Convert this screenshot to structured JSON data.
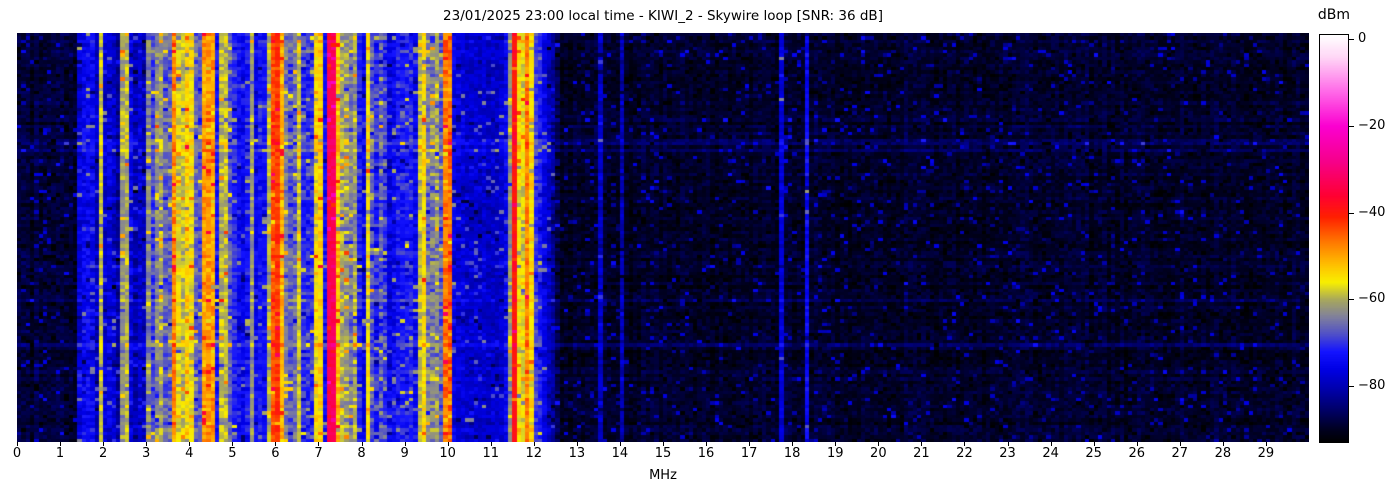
{
  "header": {
    "title": "23/01/2025 23:00 local time - KIWI_2 - Skywire loop [SNR: 36 dB]"
  },
  "chart_data": {
    "type": "heatmap",
    "subtype": "radio-spectrum-waterfall",
    "title": "23/01/2025 23:00 local time - KIWI_2 - Skywire loop [SNR: 36 dB]",
    "xlabel": "MHz",
    "x_range": [
      0,
      30
    ],
    "x_ticks": [
      0,
      1,
      2,
      3,
      4,
      5,
      6,
      7,
      8,
      9,
      10,
      11,
      12,
      13,
      14,
      15,
      16,
      17,
      18,
      19,
      20,
      21,
      22,
      23,
      24,
      25,
      26,
      27,
      28,
      29
    ],
    "y_ticks": [],
    "grid": false,
    "colorbar": {
      "label": "dBm",
      "tick_values": [
        0,
        -20,
        -40,
        -60,
        -80
      ],
      "tick_labels": [
        "0",
        "−20",
        "−40",
        "−60",
        "−80"
      ],
      "vmax": 1,
      "vmin": -93
    },
    "colormap_stops": [
      [
        -93,
        "#000000"
      ],
      [
        -90,
        "#000020"
      ],
      [
        -86,
        "#000060"
      ],
      [
        -81,
        "#0000a8"
      ],
      [
        -76,
        "#0000e6"
      ],
      [
        -72,
        "#1414ff"
      ],
      [
        -68,
        "#5050c8"
      ],
      [
        -64,
        "#80809c"
      ],
      [
        -60,
        "#a8a85c"
      ],
      [
        -56,
        "#f8ef00"
      ],
      [
        -52,
        "#ffc000"
      ],
      [
        -47,
        "#ff7c00"
      ],
      [
        -41,
        "#ff2000"
      ],
      [
        -36,
        "#ff0033"
      ],
      [
        -28,
        "#f6008c"
      ],
      [
        -20,
        "#fb00d0"
      ],
      [
        -12,
        "#ff69e8"
      ],
      [
        -4,
        "#ffd7f6"
      ],
      [
        1,
        "#ffffff"
      ]
    ],
    "noise_floor_dbm": -89.5,
    "bands": [
      {
        "f1": 0.0,
        "f2": 1.42,
        "dbm": -89,
        "colvar": 1.5,
        "cellvar": 3
      },
      {
        "f1": 1.42,
        "f2": 2.3,
        "dbm": -77,
        "colvar": 5,
        "cellvar": 5
      },
      {
        "f1": 1.93,
        "f2": 2.02,
        "dbm": -59,
        "colvar": 2,
        "cellvar": 4
      },
      {
        "f1": 2.3,
        "f2": 2.45,
        "dbm": -82,
        "colvar": 4,
        "cellvar": 5
      },
      {
        "f1": 2.45,
        "f2": 2.62,
        "dbm": -59,
        "colvar": 3,
        "cellvar": 5
      },
      {
        "f1": 2.62,
        "f2": 3.0,
        "dbm": -77,
        "colvar": 6,
        "cellvar": 6
      },
      {
        "f1": 3.0,
        "f2": 3.6,
        "dbm": -65,
        "colvar": 6,
        "cellvar": 6
      },
      {
        "f1": 3.6,
        "f2": 3.72,
        "dbm": -47,
        "colvar": 2,
        "cellvar": 6
      },
      {
        "f1": 3.72,
        "f2": 4.1,
        "dbm": -57,
        "colvar": 4,
        "cellvar": 5
      },
      {
        "f1": 4.1,
        "f2": 4.35,
        "dbm": -68,
        "colvar": 5,
        "cellvar": 5
      },
      {
        "f1": 4.35,
        "f2": 4.6,
        "dbm": -49,
        "colvar": 3,
        "cellvar": 5
      },
      {
        "f1": 4.6,
        "f2": 4.72,
        "dbm": -72,
        "colvar": 3,
        "cellvar": 4
      },
      {
        "f1": 4.72,
        "f2": 4.88,
        "dbm": -57,
        "colvar": 3,
        "cellvar": 5
      },
      {
        "f1": 4.88,
        "f2": 5.05,
        "dbm": -66,
        "colvar": 5,
        "cellvar": 6
      },
      {
        "f1": 5.05,
        "f2": 5.45,
        "dbm": -74,
        "colvar": 4,
        "cellvar": 5
      },
      {
        "f1": 5.45,
        "f2": 5.52,
        "dbm": -61,
        "colvar": 2,
        "cellvar": 4
      },
      {
        "f1": 5.52,
        "f2": 5.78,
        "dbm": -74,
        "colvar": 3,
        "cellvar": 4
      },
      {
        "f1": 5.78,
        "f2": 5.94,
        "dbm": -58,
        "colvar": 3,
        "cellvar": 5
      },
      {
        "f1": 5.94,
        "f2": 6.06,
        "dbm": -42,
        "colvar": 2,
        "cellvar": 4
      },
      {
        "f1": 6.06,
        "f2": 6.2,
        "dbm": -51,
        "colvar": 3,
        "cellvar": 5
      },
      {
        "f1": 6.2,
        "f2": 6.55,
        "dbm": -65,
        "colvar": 5,
        "cellvar": 6
      },
      {
        "f1": 6.55,
        "f2": 6.64,
        "dbm": -58,
        "colvar": 2,
        "cellvar": 4
      },
      {
        "f1": 6.64,
        "f2": 6.9,
        "dbm": -70,
        "colvar": 5,
        "cellvar": 6
      },
      {
        "f1": 6.9,
        "f2": 7.1,
        "dbm": -55,
        "colvar": 3,
        "cellvar": 5
      },
      {
        "f1": 7.1,
        "f2": 7.22,
        "dbm": -72,
        "colvar": 3,
        "cellvar": 4
      },
      {
        "f1": 7.22,
        "f2": 7.36,
        "dbm": -33,
        "colvar": 1,
        "cellvar": 3
      },
      {
        "f1": 7.36,
        "f2": 7.52,
        "dbm": -52,
        "colvar": 3,
        "cellvar": 5
      },
      {
        "f1": 7.52,
        "f2": 7.9,
        "dbm": -63,
        "colvar": 5,
        "cellvar": 6
      },
      {
        "f1": 7.9,
        "f2": 8.15,
        "dbm": -73,
        "colvar": 4,
        "cellvar": 5
      },
      {
        "f1": 8.15,
        "f2": 8.25,
        "dbm": -56,
        "colvar": 2,
        "cellvar": 4
      },
      {
        "f1": 8.25,
        "f2": 8.6,
        "dbm": -68,
        "colvar": 5,
        "cellvar": 7
      },
      {
        "f1": 8.6,
        "f2": 9.3,
        "dbm": -74,
        "colvar": 4,
        "cellvar": 5
      },
      {
        "f1": 9.3,
        "f2": 9.45,
        "dbm": -59,
        "colvar": 3,
        "cellvar": 5
      },
      {
        "f1": 9.45,
        "f2": 9.55,
        "dbm": -55,
        "colvar": 2,
        "cellvar": 4
      },
      {
        "f1": 9.55,
        "f2": 9.95,
        "dbm": -63,
        "colvar": 5,
        "cellvar": 6
      },
      {
        "f1": 9.95,
        "f2": 10.08,
        "dbm": -48,
        "colvar": 2,
        "cellvar": 6
      },
      {
        "f1": 10.08,
        "f2": 11.45,
        "dbm": -77,
        "colvar": 3,
        "cellvar": 4
      },
      {
        "f1": 11.45,
        "f2": 11.5,
        "dbm": -60,
        "colvar": 2,
        "cellvar": 4
      },
      {
        "f1": 11.5,
        "f2": 11.62,
        "dbm": -39,
        "colvar": 2,
        "cellvar": 3
      },
      {
        "f1": 11.62,
        "f2": 11.78,
        "dbm": -55,
        "colvar": 3,
        "cellvar": 4
      },
      {
        "f1": 11.78,
        "f2": 11.88,
        "dbm": -48,
        "colvar": 2,
        "cellvar": 5
      },
      {
        "f1": 11.88,
        "f2": 12.0,
        "dbm": -55,
        "colvar": 2,
        "cellvar": 4
      },
      {
        "f1": 12.0,
        "f2": 12.15,
        "dbm": -70,
        "colvar": 2,
        "cellvar": 4
      },
      {
        "f1": 13.5,
        "f2": 13.6,
        "dbm": -80,
        "colvar": 2,
        "cellvar": 5
      },
      {
        "f1": 14.0,
        "f2": 14.1,
        "dbm": -80,
        "colvar": 2,
        "cellvar": 5
      },
      {
        "f1": 17.7,
        "f2": 17.78,
        "dbm": -77,
        "colvar": 1,
        "cellvar": 3
      },
      {
        "f1": 18.28,
        "f2": 18.36,
        "dbm": -74,
        "colvar": 1,
        "cellvar": 4
      }
    ],
    "fade_bands": [
      {
        "f1": 12.15,
        "f2": 12.6,
        "dbm1": -72,
        "dbm2": -88
      }
    ],
    "render": {
      "cols": 300,
      "rows": 120,
      "seed": 20250123,
      "row_jitter_db": 1.8,
      "bright_row_prob": 0.06,
      "bright_row_db": 3.5,
      "spike_prob": 0.055,
      "spike_min_db": 5,
      "spike_extra_db": 9,
      "drop_prob": 0.04,
      "drop_min_db": 4,
      "drop_extra_db": 6
    }
  }
}
